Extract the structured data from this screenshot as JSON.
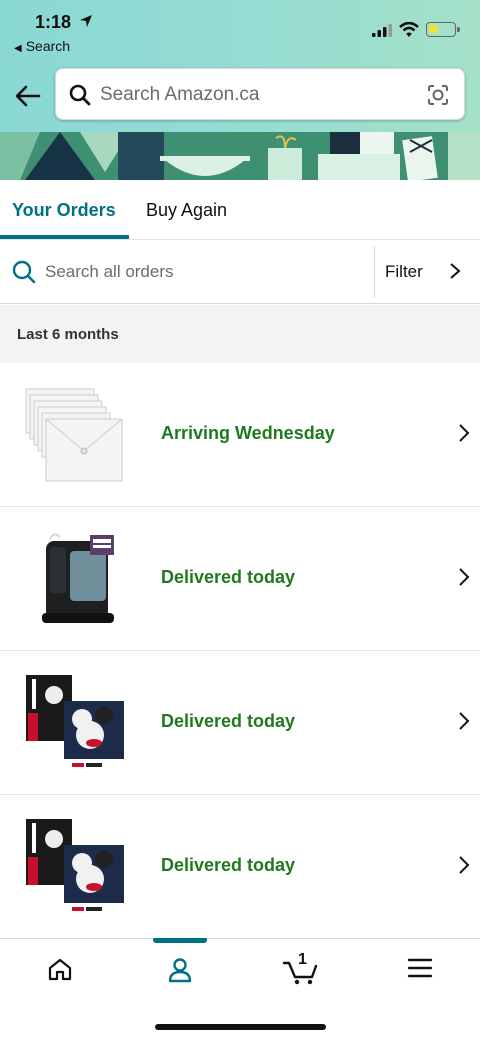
{
  "status_bar": {
    "time": "1:18",
    "back_app": "Search"
  },
  "header": {
    "search_placeholder": "Search Amazon.ca"
  },
  "tabs": [
    {
      "label": "Your Orders",
      "active": true
    },
    {
      "label": "Buy Again",
      "active": false
    }
  ],
  "order_search": {
    "placeholder": "Search all orders",
    "filter_label": "Filter"
  },
  "section_title": "Last 6 months",
  "orders": [
    {
      "status": "Arriving Wednesday",
      "thumbnail": "clear-envelopes"
    },
    {
      "status": "Delivered today",
      "thumbnail": "humidifier"
    },
    {
      "status": "Delivered today",
      "thumbnail": "lego-mickey-art"
    },
    {
      "status": "Delivered today",
      "thumbnail": "lego-mickey-art"
    }
  ],
  "bottom_nav": {
    "items": [
      "home-icon",
      "account-icon",
      "cart-icon",
      "menu-icon"
    ],
    "cart_count": "1"
  },
  "colors": {
    "accent": "#007185",
    "delivered_green": "#1f7a1f",
    "header_teal": "#8ad8d4"
  }
}
